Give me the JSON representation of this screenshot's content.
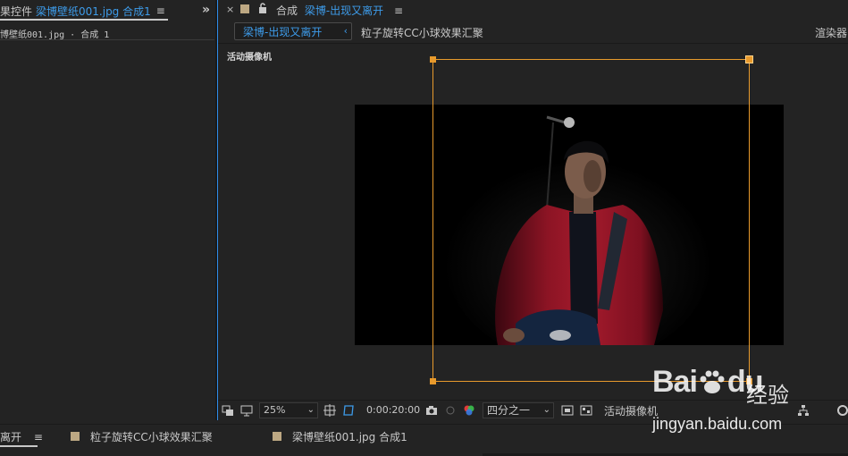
{
  "left_panel": {
    "tab_prefix": "果控件",
    "tab_layer": "梁博壁纸001.jpg 合成1",
    "menu_icon": "≡",
    "expand_icon": "»",
    "subheader": "博壁纸001.jpg · 合成 1"
  },
  "comp_panel": {
    "close_icon": "×",
    "title_prefix": "合成",
    "title_name": "梁博-出现又离开",
    "menu_icon": "≡",
    "tabs": [
      {
        "label": "梁博-出现又离开",
        "arrow": "‹"
      },
      {
        "label": "粒子旋转CC小球效果汇聚"
      },
      {
        "label": "渲染器"
      }
    ],
    "camera_label": "活动摄像机",
    "toolbar": {
      "zoom": "25%",
      "timecode": "0:00:20:00",
      "resolution": "四分之一",
      "view": "活动摄像机"
    }
  },
  "bottom_tabs": [
    {
      "label": "离开",
      "menu_icon": "≡"
    },
    {
      "label": "粒子旋转CC小球效果汇聚"
    },
    {
      "label": "梁博壁纸001.jpg 合成1"
    }
  ],
  "watermark": {
    "brand": "Bai",
    "brand2": "du",
    "product": "经验",
    "url": "jingyan.baidu.com"
  },
  "colors": {
    "accent_blue": "#3d9be9",
    "bbox_orange": "#e89a2c",
    "swatch_tan": "#bda883",
    "background": "#232323"
  }
}
